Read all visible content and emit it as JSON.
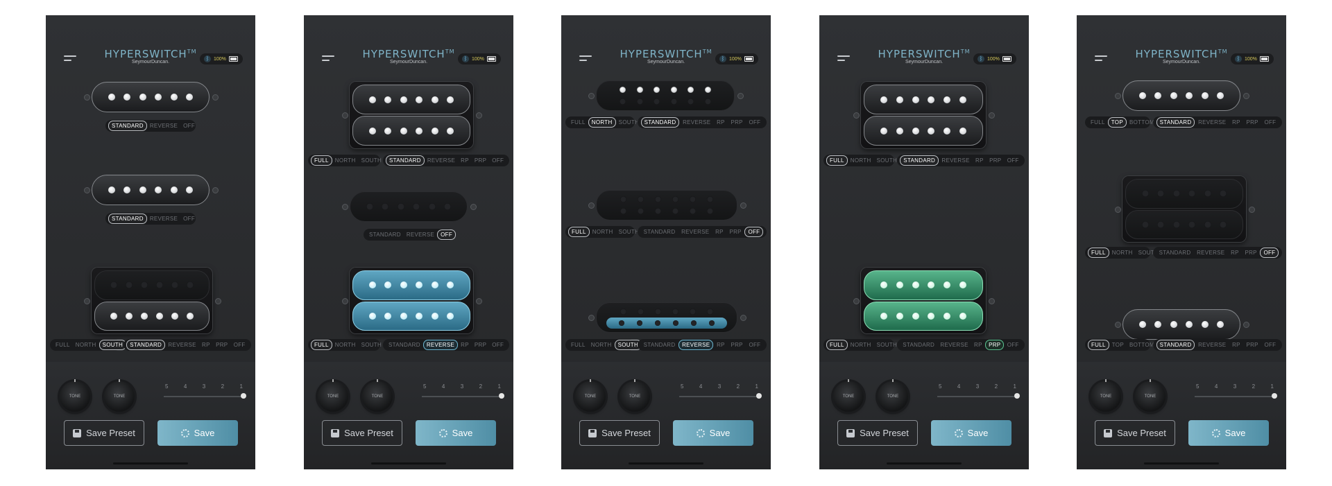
{
  "app": {
    "title": "HYPERSWITCH",
    "trademark": "TM",
    "brand": "SeymourDuncan.",
    "battery": "100%"
  },
  "controls": {
    "tone_label": "TONE",
    "scale": [
      "5",
      "4",
      "3",
      "2",
      "1"
    ],
    "save_preset_label": "Save Preset",
    "save_label": "Save"
  },
  "icons": {
    "bluetooth": "bluetooth-icon",
    "battery": "battery-icon",
    "menu": "hamburger-menu-icon",
    "save_preset": "floppy-disk-icon",
    "save": "gear-icon"
  },
  "colors": {
    "accent": "#7fb4c8",
    "blue_active": "#4f9ab6",
    "green_active": "#2f8a62",
    "panel": "#2a2c2f"
  },
  "screens": [
    {
      "pickups": [
        {
          "type": "single",
          "state": "on"
        },
        {
          "type": "single",
          "state": "on"
        },
        {
          "type": "humbucker",
          "top": "off",
          "bottom": "on"
        }
      ],
      "selectors": [
        {
          "coil": null,
          "mode": [
            "STANDARD",
            "REVERSE",
            "OFF"
          ],
          "mode_sel": 0
        },
        {
          "coil": null,
          "mode": [
            "STANDARD",
            "REVERSE",
            "OFF"
          ],
          "mode_sel": 0
        },
        {
          "coil": [
            "FULL",
            "NORTH",
            "SOUTH"
          ],
          "coil_sel": 2,
          "mode": [
            "STANDARD",
            "REVERSE",
            "RP",
            "PRP",
            "OFF"
          ],
          "mode_sel": 0
        }
      ]
    },
    {
      "pickups": [
        {
          "type": "humbucker",
          "top": "on",
          "bottom": "on"
        },
        {
          "type": "single",
          "state": "off"
        },
        {
          "type": "humbucker",
          "top": "blue",
          "bottom": "blue"
        }
      ],
      "selectors": [
        {
          "coil": [
            "FULL",
            "NORTH",
            "SOUTH"
          ],
          "coil_sel": 0,
          "mode": [
            "STANDARD",
            "REVERSE",
            "RP",
            "PRP",
            "OFF"
          ],
          "mode_sel": 0
        },
        {
          "coil": null,
          "mode": [
            "STANDARD",
            "REVERSE",
            "OFF"
          ],
          "mode_sel": 2
        },
        {
          "coil": [
            "FULL",
            "NORTH",
            "SOUTH"
          ],
          "coil_sel": 0,
          "mode": [
            "STANDARD",
            "REVERSE",
            "RP",
            "PRP",
            "OFF"
          ],
          "mode_sel": 1,
          "accent": "blue"
        }
      ]
    },
    {
      "pickups": [
        {
          "type": "rail",
          "state": "north"
        },
        {
          "type": "rail",
          "state": "off"
        },
        {
          "type": "rail",
          "state": "blue-south"
        }
      ],
      "selectors": [
        {
          "coil": [
            "FULL",
            "NORTH",
            "SOUTH"
          ],
          "coil_sel": 1,
          "mode": [
            "STANDARD",
            "REVERSE",
            "RP",
            "PRP",
            "OFF"
          ],
          "mode_sel": 0
        },
        {
          "coil": [
            "FULL",
            "NORTH",
            "SOUTH"
          ],
          "coil_sel": 0,
          "mode": [
            "STANDARD",
            "REVERSE",
            "RP",
            "PRP",
            "OFF"
          ],
          "mode_sel": 4
        },
        {
          "coil": [
            "FULL",
            "NORTH",
            "SOUTH"
          ],
          "coil_sel": 2,
          "mode": [
            "STANDARD",
            "REVERSE",
            "RP",
            "PRP",
            "OFF"
          ],
          "mode_sel": 1,
          "accent": "blue"
        }
      ]
    },
    {
      "pickups": [
        {
          "type": "humbucker",
          "top": "on",
          "bottom": "on"
        },
        {
          "type": "none"
        },
        {
          "type": "humbucker",
          "top": "green",
          "bottom": "green"
        }
      ],
      "selectors": [
        {
          "coil": [
            "FULL",
            "NORTH",
            "SOUTH"
          ],
          "coil_sel": 0,
          "mode": [
            "STANDARD",
            "REVERSE",
            "RP",
            "PRP",
            "OFF"
          ],
          "mode_sel": 0
        },
        null,
        {
          "coil": [
            "FULL",
            "NORTH",
            "SOUTH"
          ],
          "coil_sel": 0,
          "mode": [
            "STANDARD",
            "REVERSE",
            "RP",
            "PRP",
            "OFF"
          ],
          "mode_sel": 3,
          "accent": "green"
        }
      ]
    },
    {
      "pickups": [
        {
          "type": "single",
          "state": "on"
        },
        {
          "type": "humbucker",
          "top": "off",
          "bottom": "off"
        },
        {
          "type": "single",
          "state": "on"
        }
      ],
      "selectors": [
        {
          "coil": [
            "FULL",
            "TOP",
            "BOTTOM"
          ],
          "coil_sel": 1,
          "mode": [
            "STANDARD",
            "REVERSE",
            "RP",
            "PRP",
            "OFF"
          ],
          "mode_sel": 0
        },
        {
          "coil": [
            "FULL",
            "NORTH",
            "SOUTH"
          ],
          "coil_sel": 0,
          "mode": [
            "STANDARD",
            "REVERSE",
            "RP",
            "PRP",
            "OFF"
          ],
          "mode_sel": 4
        },
        {
          "coil": [
            "FULL",
            "TOP",
            "BOTTOM"
          ],
          "coil_sel": 0,
          "mode": [
            "STANDARD",
            "REVERSE",
            "RP",
            "PRP",
            "OFF"
          ],
          "mode_sel": 0
        }
      ]
    }
  ]
}
